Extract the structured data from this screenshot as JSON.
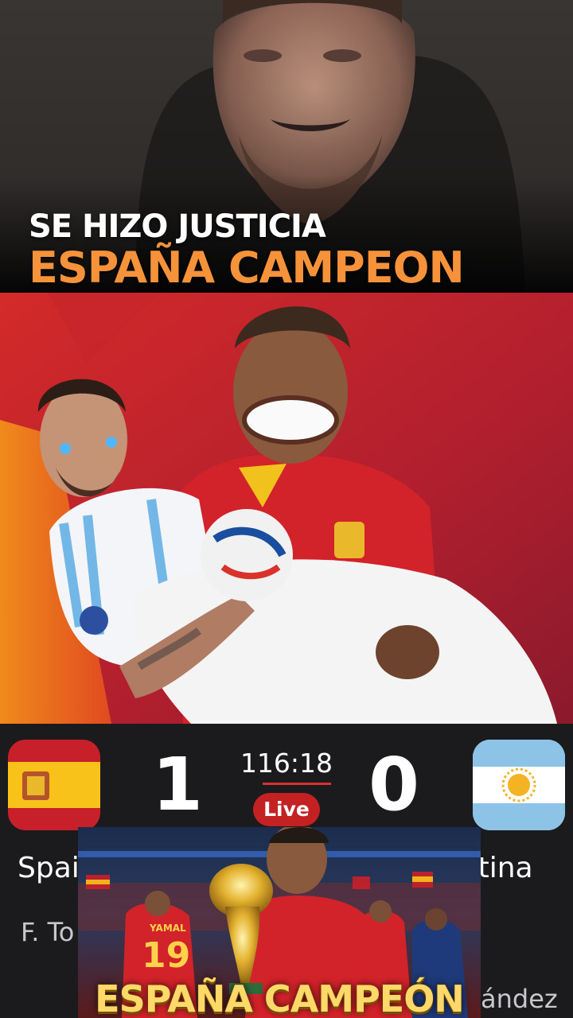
{
  "headline": {
    "line1": "SE HIZO JUSTICIA",
    "line2": "ESPAÑA CAMPEON"
  },
  "scoreboard": {
    "home_score": "1",
    "away_score": "0",
    "match_time": "116:18",
    "live_label": "Live",
    "home_team": "Spain",
    "away_team": "Argentina",
    "home_scorer": "F. To",
    "away_scorer": "ández"
  },
  "overlay": {
    "title": "ESPAÑA CAMPEÓN",
    "jersey_name": "YAMAL",
    "jersey_number": "19"
  },
  "colors": {
    "headline_accent": "#f6923a",
    "live_badge": "#c42222",
    "score_panel_bg": "#1b1b1d",
    "overlay_title": "#ffd86a"
  },
  "icons": {
    "home_flag": "spain-flag-icon",
    "away_flag": "argentina-flag-icon"
  }
}
